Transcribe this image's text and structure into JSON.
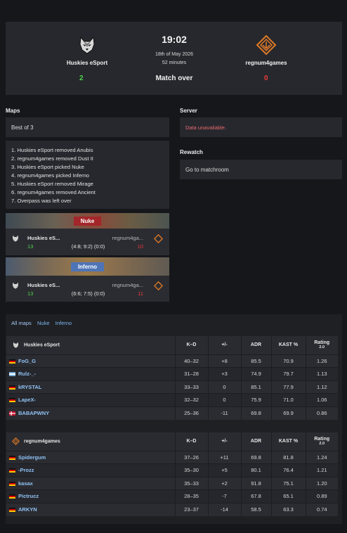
{
  "match": {
    "team1": {
      "name": "Huskies eSport",
      "score": "2"
    },
    "team2": {
      "name": "regnum4games",
      "score": "0"
    },
    "time": "19:02",
    "date": "18th of May 2026",
    "duration": "52 minutes",
    "status": "Match over"
  },
  "maps": {
    "label": "Maps",
    "format": "Best of 3",
    "veto": [
      "1. Huskies eSport removed Anubis",
      "2. regnum4games removed Dust II",
      "3. Huskies eSport picked Nuke",
      "4. regnum4games picked Inferno",
      "5. Huskies eSport removed Mirage",
      "6. regnum4games removed Ancient",
      "7. Overpass was left over"
    ],
    "results": [
      {
        "map": "Nuke",
        "team1": "Huskies eS...",
        "team2": "regnum4ga...",
        "score1": "13",
        "score2": "10",
        "halves": "(4:8; 9:2) (0:0)"
      },
      {
        "map": "Inferno",
        "team1": "Huskies eS...",
        "team2": "regnum4ga...",
        "score1": "13",
        "score2": "11",
        "halves": "(6:6; 7:5) (0:0)"
      }
    ]
  },
  "server": {
    "label": "Server",
    "text": "Data unavailable."
  },
  "rewatch": {
    "label": "Rewatch",
    "link": "Go to matchroom"
  },
  "stats": {
    "tabs": [
      "All maps",
      "Nuke",
      "Inferno"
    ],
    "headers": {
      "kd": "K–D",
      "pm": "+/-",
      "adr": "ADR",
      "kast": "KAST %",
      "rating": "Rating",
      "rating_sub": "2.0"
    },
    "team1": {
      "name": "Huskies eSport",
      "players": [
        {
          "name": "FoG_G",
          "flag": "de",
          "kd": "40–32",
          "pm": "+8",
          "adr": "85.5",
          "kast": "70.9",
          "rating": "1.26"
        },
        {
          "name": "Rulz-_-",
          "flag": "ar",
          "kd": "31–28",
          "pm": "+3",
          "adr": "74.9",
          "kast": "79.7",
          "rating": "1.13"
        },
        {
          "name": "kRYSTAL",
          "flag": "de",
          "kd": "33–33",
          "pm": "0",
          "adr": "85.1",
          "kast": "77.9",
          "rating": "1.12"
        },
        {
          "name": "LapeX-",
          "flag": "de",
          "kd": "32–32",
          "pm": "0",
          "adr": "75.9",
          "kast": "71.0",
          "rating": "1.06"
        },
        {
          "name": "BABAPWNY",
          "flag": "dk",
          "kd": "25–36",
          "pm": "-11",
          "adr": "69.8",
          "kast": "69.9",
          "rating": "0.86"
        }
      ]
    },
    "team2": {
      "name": "regnum4games",
      "players": [
        {
          "name": "Spidergum",
          "flag": "de",
          "kd": "37–26",
          "pm": "+11",
          "adr": "69.8",
          "kast": "81.8",
          "rating": "1.24"
        },
        {
          "name": "-Prozz",
          "flag": "de",
          "kd": "35–30",
          "pm": "+5",
          "adr": "80.1",
          "kast": "76.4",
          "rating": "1.21"
        },
        {
          "name": "kasax",
          "flag": "de",
          "kd": "35–33",
          "pm": "+2",
          "adr": "91.8",
          "kast": "75.1",
          "rating": "1.20"
        },
        {
          "name": "Pictrucz",
          "flag": "de",
          "kd": "28–35",
          "pm": "-7",
          "adr": "67.8",
          "kast": "65.1",
          "rating": "0.89"
        },
        {
          "name": "ARKYN",
          "flag": "de",
          "kd": "23–37",
          "pm": "-14",
          "adr": "58.5",
          "kast": "63.3",
          "rating": "0.74"
        }
      ]
    }
  }
}
